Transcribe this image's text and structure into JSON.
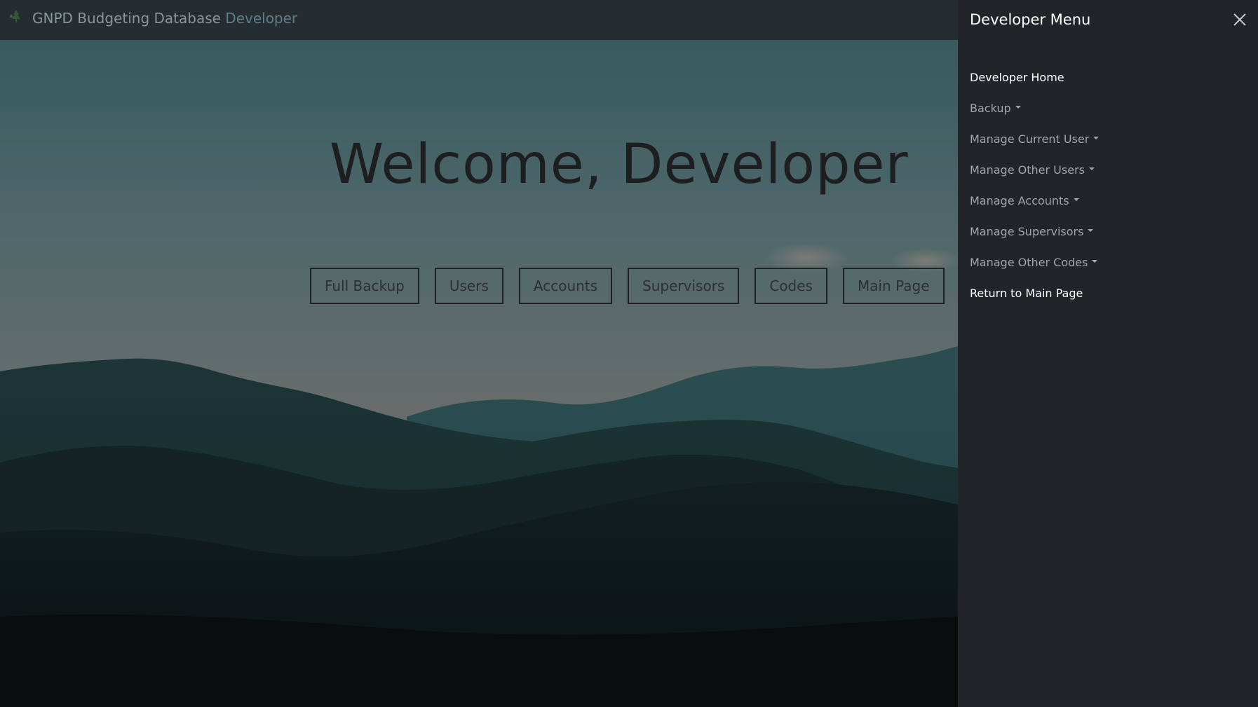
{
  "navbar": {
    "brand_name": "GNPD Budgeting Database",
    "brand_accent": "Developer",
    "logo_icon": "tree-logo-icon"
  },
  "hero": {
    "title": "Welcome, Developer",
    "buttons": [
      {
        "label": "Full Backup"
      },
      {
        "label": "Users"
      },
      {
        "label": "Accounts"
      },
      {
        "label": "Supervisors"
      },
      {
        "label": "Codes"
      },
      {
        "label": "Main Page"
      }
    ]
  },
  "offcanvas": {
    "title": "Developer Menu",
    "close_icon": "close-icon",
    "items": [
      {
        "label": "Developer Home",
        "dropdown": false,
        "active": true
      },
      {
        "label": "Backup",
        "dropdown": true,
        "active": false
      },
      {
        "label": "Manage Current User",
        "dropdown": true,
        "active": false
      },
      {
        "label": "Manage Other Users",
        "dropdown": true,
        "active": false
      },
      {
        "label": "Manage Accounts",
        "dropdown": true,
        "active": false
      },
      {
        "label": "Manage Supervisors",
        "dropdown": true,
        "active": false
      },
      {
        "label": "Manage Other Codes",
        "dropdown": true,
        "active": false
      },
      {
        "label": "Return to Main Page",
        "dropdown": false,
        "active": true
      }
    ]
  },
  "colors": {
    "navbar_bg": "#262d30",
    "offcanvas_bg": "#212529",
    "menu_text": "#a3a6a8",
    "menu_text_active": "#ffffff",
    "accent": "#5f7f8a"
  }
}
